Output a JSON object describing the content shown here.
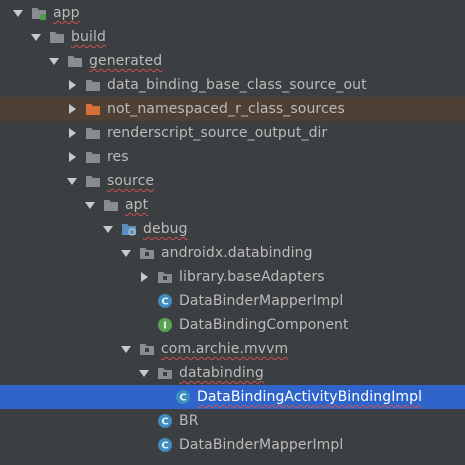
{
  "colors": {
    "background": "#3c3f41",
    "selection": "#2f65ca",
    "highlight_row": "#4e4035",
    "folder": "#8a8d8f",
    "folder_orange": "#d4703a",
    "class_badge": "#3d8ebf",
    "interface_badge": "#5aa353",
    "error_underline": "#c94f4f"
  },
  "tree": [
    {
      "label": "app",
      "icon": "module-folder-icon",
      "arrow": "down",
      "depth": 0,
      "squiggle": true
    },
    {
      "label": "build",
      "icon": "folder-icon",
      "arrow": "down",
      "depth": 1,
      "squiggle": true
    },
    {
      "label": "generated",
      "icon": "folder-icon",
      "arrow": "down",
      "depth": 2,
      "squiggle": true
    },
    {
      "label": "data_binding_base_class_source_out",
      "icon": "folder-icon",
      "arrow": "right",
      "depth": 3
    },
    {
      "label": "not_namespaced_r_class_sources",
      "icon": "folder-orange-icon",
      "arrow": "right",
      "depth": 3,
      "highlighted": true
    },
    {
      "label": "renderscript_source_output_dir",
      "icon": "folder-icon",
      "arrow": "right",
      "depth": 3
    },
    {
      "label": "res",
      "icon": "folder-icon",
      "arrow": "right",
      "depth": 3
    },
    {
      "label": "source",
      "icon": "folder-icon",
      "arrow": "down",
      "depth": 3,
      "squiggle": true
    },
    {
      "label": "apt",
      "icon": "folder-icon",
      "arrow": "down",
      "depth": 4,
      "squiggle": true
    },
    {
      "label": "debug",
      "icon": "source-root-folder-icon",
      "arrow": "down",
      "depth": 5,
      "squiggle": true
    },
    {
      "label": "androidx.databinding",
      "icon": "package-icon",
      "arrow": "down",
      "depth": 6
    },
    {
      "label": "library.baseAdapters",
      "icon": "package-icon",
      "arrow": "right",
      "depth": 7
    },
    {
      "label": "DataBinderMapperImpl",
      "icon": "class-icon",
      "arrow": "none",
      "depth": 7
    },
    {
      "label": "DataBindingComponent",
      "icon": "interface-icon",
      "arrow": "none",
      "depth": 7
    },
    {
      "label": "com.archie.mvvm",
      "icon": "package-icon",
      "arrow": "down",
      "depth": 6,
      "squiggle": true
    },
    {
      "label": "databinding",
      "icon": "package-icon",
      "arrow": "down",
      "depth": 7,
      "squiggle": true
    },
    {
      "label": "DataBindingActivityBindingImpl",
      "icon": "class-icon",
      "arrow": "none",
      "depth": 8,
      "selected": true,
      "squiggle": true
    },
    {
      "label": "BR",
      "icon": "class-icon",
      "arrow": "none",
      "depth": 7
    },
    {
      "label": "DataBinderMapperImpl",
      "icon": "class-icon",
      "arrow": "none",
      "depth": 7
    }
  ]
}
